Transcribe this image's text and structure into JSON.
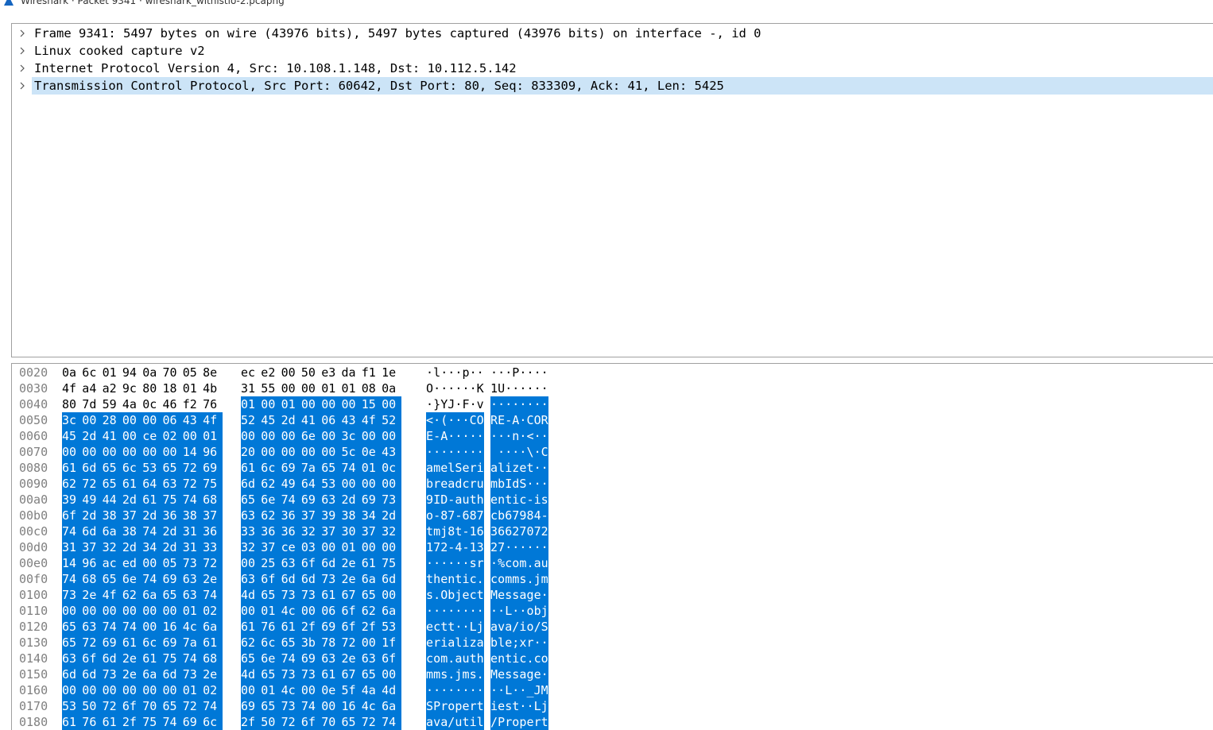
{
  "window": {
    "title": "Wireshark · Packet 9341 · wireshark_withistio-2.pcapng",
    "accent": "#0078d7",
    "selection_bg": "#cce4f7"
  },
  "tree": [
    {
      "text": "Frame 9341: 5497 bytes on wire (43976 bits), 5497 bytes captured (43976 bits) on interface -, id 0",
      "selected": false
    },
    {
      "text": "Linux cooked capture v2",
      "selected": false
    },
    {
      "text": "Internet Protocol Version 4, Src: 10.108.1.148, Dst: 10.112.5.142",
      "selected": false
    },
    {
      "text": "Transmission Control Protocol, Src Port: 60642, Dst Port: 80, Seq: 833309, Ack: 41, Len: 5425",
      "selected": true
    }
  ],
  "hex_rows": [
    {
      "offset": "0020",
      "bytes": [
        "0a",
        "6c",
        "01",
        "94",
        "0a",
        "70",
        "05",
        "8e",
        "ec",
        "e2",
        "00",
        "50",
        "e3",
        "da",
        "f1",
        "1e"
      ],
      "ascii": "·l···p·· ···P····",
      "sel_from": 16
    },
    {
      "offset": "0030",
      "bytes": [
        "4f",
        "a4",
        "a2",
        "9c",
        "80",
        "18",
        "01",
        "4b",
        "31",
        "55",
        "00",
        "00",
        "01",
        "01",
        "08",
        "0a"
      ],
      "ascii": "O······K 1U······",
      "sel_from": 16
    },
    {
      "offset": "0040",
      "bytes": [
        "80",
        "7d",
        "59",
        "4a",
        "0c",
        "46",
        "f2",
        "76",
        "01",
        "00",
        "01",
        "00",
        "00",
        "00",
        "15",
        "00"
      ],
      "ascii": "·}YJ·F·v ········",
      "sel_from": 8
    },
    {
      "offset": "0050",
      "bytes": [
        "3c",
        "00",
        "28",
        "00",
        "00",
        "06",
        "43",
        "4f",
        "52",
        "45",
        "2d",
        "41",
        "06",
        "43",
        "4f",
        "52"
      ],
      "ascii": "<·(···CO RE-A·COR",
      "sel_from": 0
    },
    {
      "offset": "0060",
      "bytes": [
        "45",
        "2d",
        "41",
        "00",
        "ce",
        "02",
        "00",
        "01",
        "00",
        "00",
        "00",
        "6e",
        "00",
        "3c",
        "00",
        "00"
      ],
      "ascii": "E-A····· ···n·<··",
      "sel_from": 0
    },
    {
      "offset": "0070",
      "bytes": [
        "00",
        "00",
        "00",
        "00",
        "00",
        "00",
        "14",
        "96",
        "20",
        "00",
        "00",
        "00",
        "00",
        "5c",
        "0e",
        "43"
      ],
      "ascii": "········  ····\\·C",
      "sel_from": 0
    },
    {
      "offset": "0080",
      "bytes": [
        "61",
        "6d",
        "65",
        "6c",
        "53",
        "65",
        "72",
        "69",
        "61",
        "6c",
        "69",
        "7a",
        "65",
        "74",
        "01",
        "0c"
      ],
      "ascii": "amelSeri alizet··",
      "sel_from": 0
    },
    {
      "offset": "0090",
      "bytes": [
        "62",
        "72",
        "65",
        "61",
        "64",
        "63",
        "72",
        "75",
        "6d",
        "62",
        "49",
        "64",
        "53",
        "00",
        "00",
        "00"
      ],
      "ascii": "breadcru mbIdS···",
      "sel_from": 0
    },
    {
      "offset": "00a0",
      "bytes": [
        "39",
        "49",
        "44",
        "2d",
        "61",
        "75",
        "74",
        "68",
        "65",
        "6e",
        "74",
        "69",
        "63",
        "2d",
        "69",
        "73"
      ],
      "ascii": "9ID-auth entic-is",
      "sel_from": 0
    },
    {
      "offset": "00b0",
      "bytes": [
        "6f",
        "2d",
        "38",
        "37",
        "2d",
        "36",
        "38",
        "37",
        "63",
        "62",
        "36",
        "37",
        "39",
        "38",
        "34",
        "2d"
      ],
      "ascii": "o-87-687 cb67984-",
      "sel_from": 0
    },
    {
      "offset": "00c0",
      "bytes": [
        "74",
        "6d",
        "6a",
        "38",
        "74",
        "2d",
        "31",
        "36",
        "33",
        "36",
        "36",
        "32",
        "37",
        "30",
        "37",
        "32"
      ],
      "ascii": "tmj8t-16 36627072",
      "sel_from": 0
    },
    {
      "offset": "00d0",
      "bytes": [
        "31",
        "37",
        "32",
        "2d",
        "34",
        "2d",
        "31",
        "33",
        "32",
        "37",
        "ce",
        "03",
        "00",
        "01",
        "00",
        "00"
      ],
      "ascii": "172-4-13 27······",
      "sel_from": 0
    },
    {
      "offset": "00e0",
      "bytes": [
        "14",
        "96",
        "ac",
        "ed",
        "00",
        "05",
        "73",
        "72",
        "00",
        "25",
        "63",
        "6f",
        "6d",
        "2e",
        "61",
        "75"
      ],
      "ascii": "······sr ·%com.au",
      "sel_from": 0
    },
    {
      "offset": "00f0",
      "bytes": [
        "74",
        "68",
        "65",
        "6e",
        "74",
        "69",
        "63",
        "2e",
        "63",
        "6f",
        "6d",
        "6d",
        "73",
        "2e",
        "6a",
        "6d"
      ],
      "ascii": "thentic. comms.jm",
      "sel_from": 0
    },
    {
      "offset": "0100",
      "bytes": [
        "73",
        "2e",
        "4f",
        "62",
        "6a",
        "65",
        "63",
        "74",
        "4d",
        "65",
        "73",
        "73",
        "61",
        "67",
        "65",
        "00"
      ],
      "ascii": "s.Object Message·",
      "sel_from": 0
    },
    {
      "offset": "0110",
      "bytes": [
        "00",
        "00",
        "00",
        "00",
        "00",
        "00",
        "01",
        "02",
        "00",
        "01",
        "4c",
        "00",
        "06",
        "6f",
        "62",
        "6a"
      ],
      "ascii": "········ ··L··obj",
      "sel_from": 0
    },
    {
      "offset": "0120",
      "bytes": [
        "65",
        "63",
        "74",
        "74",
        "00",
        "16",
        "4c",
        "6a",
        "61",
        "76",
        "61",
        "2f",
        "69",
        "6f",
        "2f",
        "53"
      ],
      "ascii": "ectt··Lj ava/io/S",
      "sel_from": 0
    },
    {
      "offset": "0130",
      "bytes": [
        "65",
        "72",
        "69",
        "61",
        "6c",
        "69",
        "7a",
        "61",
        "62",
        "6c",
        "65",
        "3b",
        "78",
        "72",
        "00",
        "1f"
      ],
      "ascii": "erializa ble;xr··",
      "sel_from": 0
    },
    {
      "offset": "0140",
      "bytes": [
        "63",
        "6f",
        "6d",
        "2e",
        "61",
        "75",
        "74",
        "68",
        "65",
        "6e",
        "74",
        "69",
        "63",
        "2e",
        "63",
        "6f"
      ],
      "ascii": "com.auth entic.co",
      "sel_from": 0
    },
    {
      "offset": "0150",
      "bytes": [
        "6d",
        "6d",
        "73",
        "2e",
        "6a",
        "6d",
        "73",
        "2e",
        "4d",
        "65",
        "73",
        "73",
        "61",
        "67",
        "65",
        "00"
      ],
      "ascii": "mms.jms. Message·",
      "sel_from": 0
    },
    {
      "offset": "0160",
      "bytes": [
        "00",
        "00",
        "00",
        "00",
        "00",
        "00",
        "01",
        "02",
        "00",
        "01",
        "4c",
        "00",
        "0e",
        "5f",
        "4a",
        "4d"
      ],
      "ascii": "········ ··L··_JM",
      "sel_from": 0
    },
    {
      "offset": "0170",
      "bytes": [
        "53",
        "50",
        "72",
        "6f",
        "70",
        "65",
        "72",
        "74",
        "69",
        "65",
        "73",
        "74",
        "00",
        "16",
        "4c",
        "6a"
      ],
      "ascii": "SPropert iest··Lj",
      "sel_from": 0
    },
    {
      "offset": "0180",
      "bytes": [
        "61",
        "76",
        "61",
        "2f",
        "75",
        "74",
        "69",
        "6c",
        "2f",
        "50",
        "72",
        "6f",
        "70",
        "65",
        "72",
        "74"
      ],
      "ascii": "ava/util /Propert",
      "sel_from": 0
    }
  ]
}
